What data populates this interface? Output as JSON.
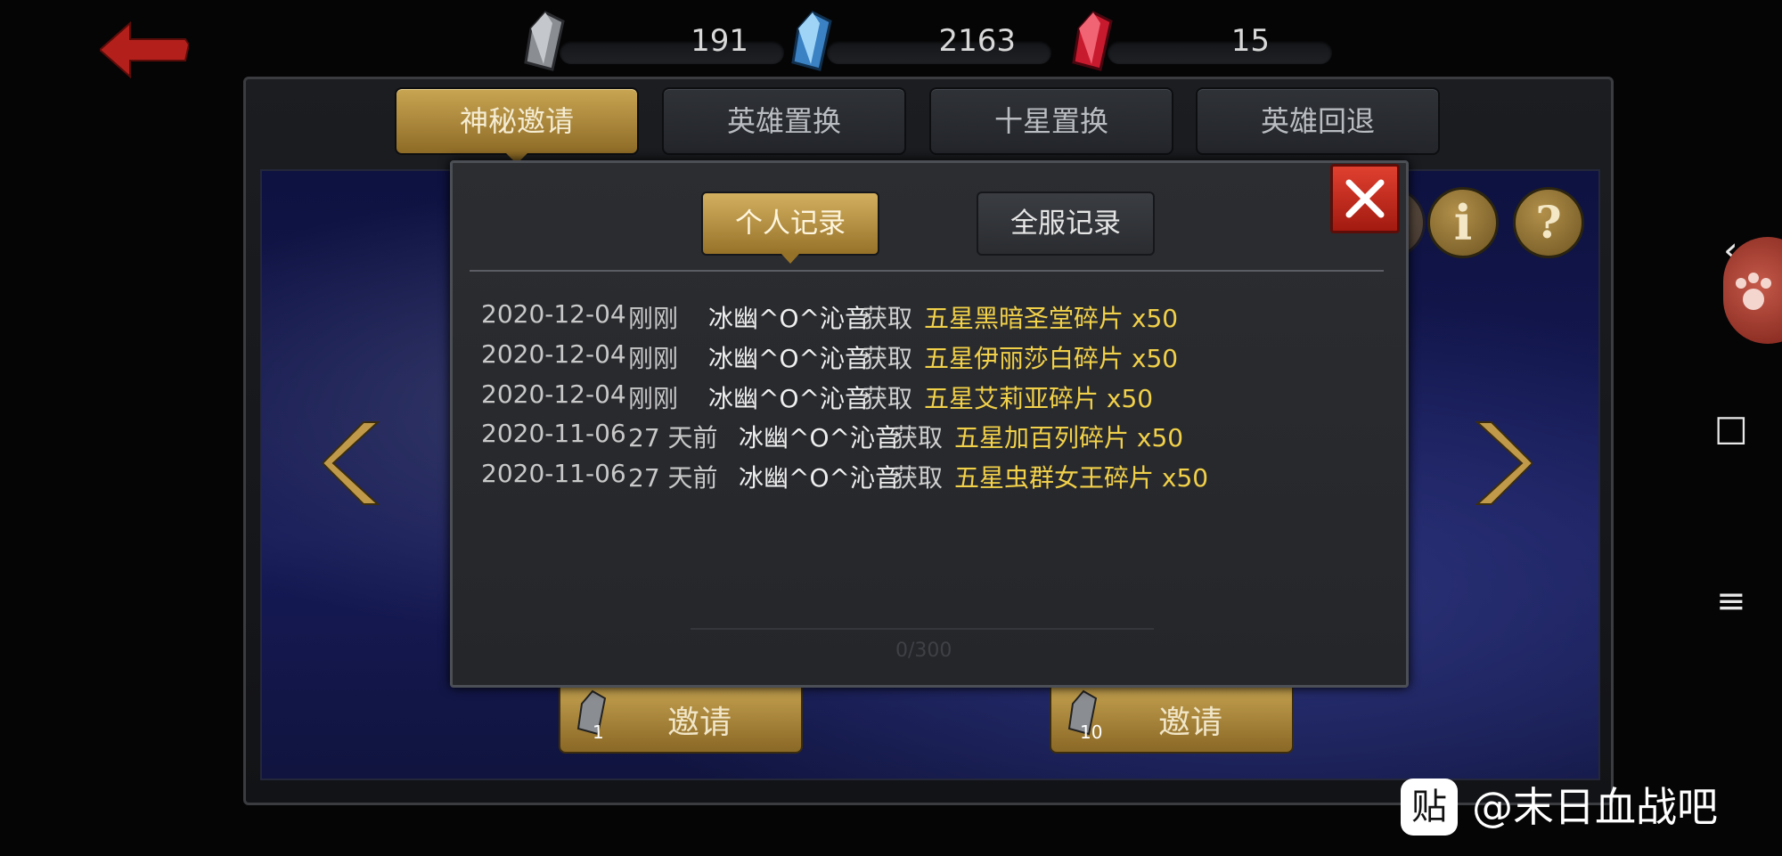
{
  "currencies": [
    {
      "name": "silver-crystal",
      "value": "191",
      "color": "#8a8d92"
    },
    {
      "name": "blue-crystal",
      "value": "2163",
      "color": "#5aa8e0"
    },
    {
      "name": "red-crystal",
      "value": "15",
      "color": "#d8233a"
    }
  ],
  "tabs": [
    {
      "label": "神秘邀请",
      "active": true
    },
    {
      "label": "英雄置换",
      "active": false
    },
    {
      "label": "十星置换",
      "active": false
    },
    {
      "label": "英雄回退",
      "active": false
    }
  ],
  "side_buttons": {
    "info": "i",
    "help": "?"
  },
  "modal": {
    "subtabs": [
      {
        "label": "个人记录",
        "active": true
      },
      {
        "label": "全服记录",
        "active": false
      }
    ],
    "records": [
      {
        "date": "2020-12-04",
        "ago": "刚刚",
        "user": "冰幽^O^沁音",
        "verb": "获取",
        "item": "五星黑暗圣堂碎片 x50"
      },
      {
        "date": "2020-12-04",
        "ago": "刚刚",
        "user": "冰幽^O^沁音",
        "verb": "获取",
        "item": "五星伊丽莎白碎片 x50"
      },
      {
        "date": "2020-12-04",
        "ago": "刚刚",
        "user": "冰幽^O^沁音",
        "verb": "获取",
        "item": "五星艾莉亚碎片 x50"
      },
      {
        "date": "2020-11-06",
        "ago": "27 天前",
        "user": "冰幽^O^沁音",
        "verb": "获取",
        "item": "五星加百列碎片 x50"
      },
      {
        "date": "2020-11-06",
        "ago": "27 天前",
        "user": "冰幽^O^沁音",
        "verb": "获取",
        "item": "五星虫群女王碎片 x50"
      }
    ],
    "progress": "0/300"
  },
  "invite_buttons": [
    {
      "label": "邀请",
      "count": "1"
    },
    {
      "label": "邀请",
      "count": "10"
    }
  ],
  "watermark": {
    "logo": "贴",
    "text": "@末日血战吧"
  },
  "system_bar": {
    "back": "‹",
    "home": "□",
    "menu": "≡"
  }
}
